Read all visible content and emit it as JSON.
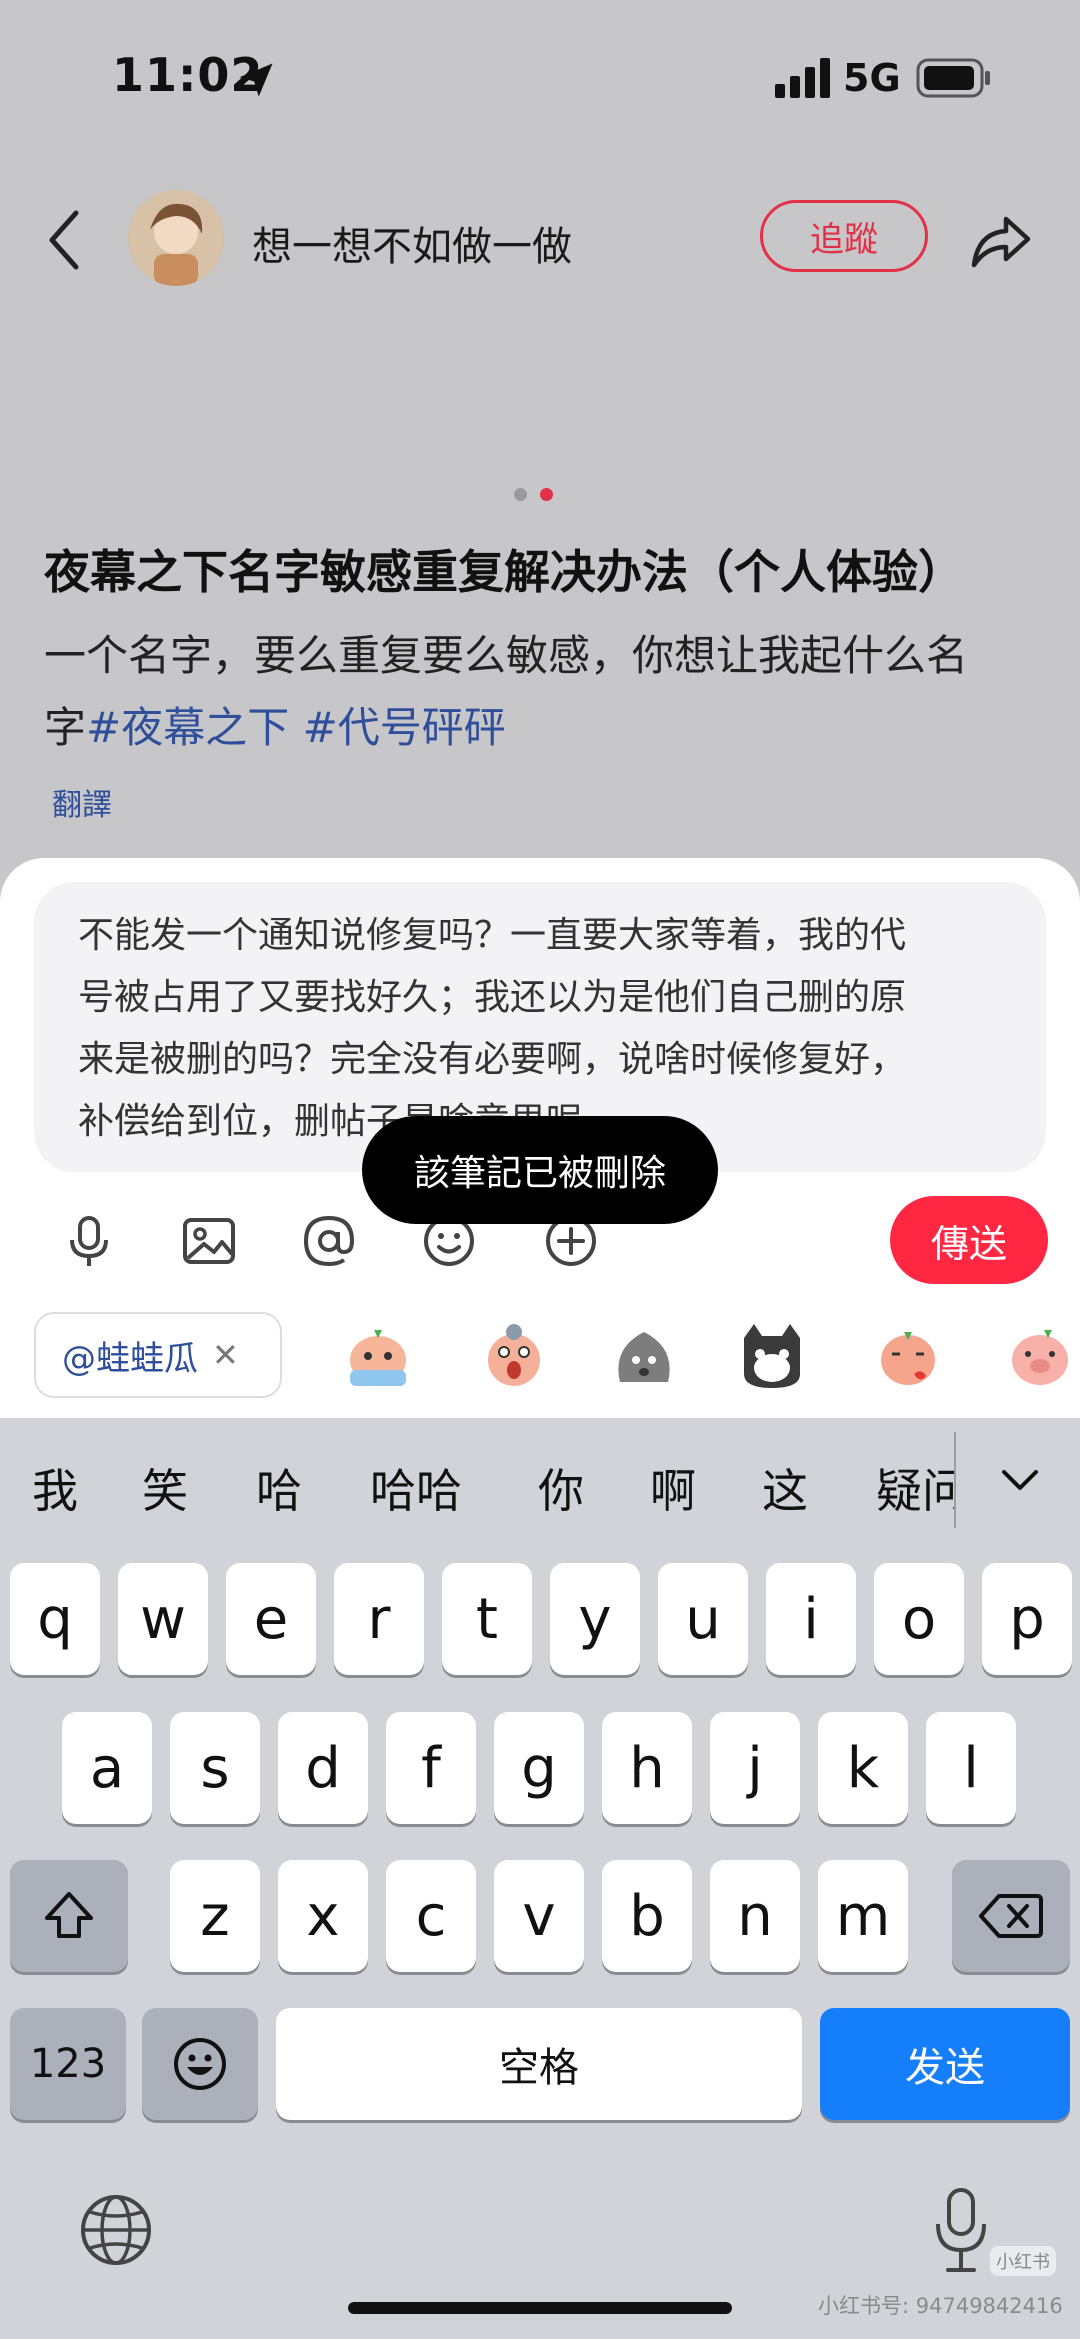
{
  "status_bar": {
    "time": "11:02",
    "network": "5G"
  },
  "header": {
    "author": "想一想不如做一做",
    "follow_label": "追蹤"
  },
  "post": {
    "title": "夜幕之下名字敏感重复解决办法（个人体验）",
    "body_line1": "一个名字，要么重复要么敏感，你想让我起什么名",
    "body_line2_prefix": "字",
    "tag1": "#夜幕之下",
    "tag2": "#代号砰砰",
    "translate_label": "翻譯"
  },
  "comment": {
    "lines": [
      "不能发一个通知说修复吗？一直要大家等着，我的代",
      "号被占用了又要找好久；我还以为是他们自己删的原",
      "来是被删的吗？完全没有必要啊，说啥时候修复好，",
      "补偿给到位，删帖子是啥意思呢"
    ],
    "send_label": "傳送",
    "mention_chip": "@蛙蛙瓜"
  },
  "toast": {
    "text": "該筆記已被刪除"
  },
  "keyboard": {
    "candidates": [
      "我",
      "笑",
      "哈",
      "哈哈",
      "你",
      "啊",
      "这",
      "疑问"
    ],
    "row1": [
      "q",
      "w",
      "e",
      "r",
      "t",
      "y",
      "u",
      "i",
      "o",
      "p"
    ],
    "row2": [
      "a",
      "s",
      "d",
      "f",
      "g",
      "h",
      "j",
      "k",
      "l"
    ],
    "row3": [
      "z",
      "x",
      "c",
      "v",
      "b",
      "n",
      "m"
    ],
    "numbers_label": "123",
    "space_label": "空格",
    "go_label": "发送"
  },
  "watermark": {
    "logo": "小红书",
    "id_text": "小红书号: 94749842416"
  },
  "colors": {
    "accent_red": "#ff2742",
    "follow_red": "#e23147",
    "link_blue": "#2f4f9a",
    "send_blue": "#147efb"
  }
}
